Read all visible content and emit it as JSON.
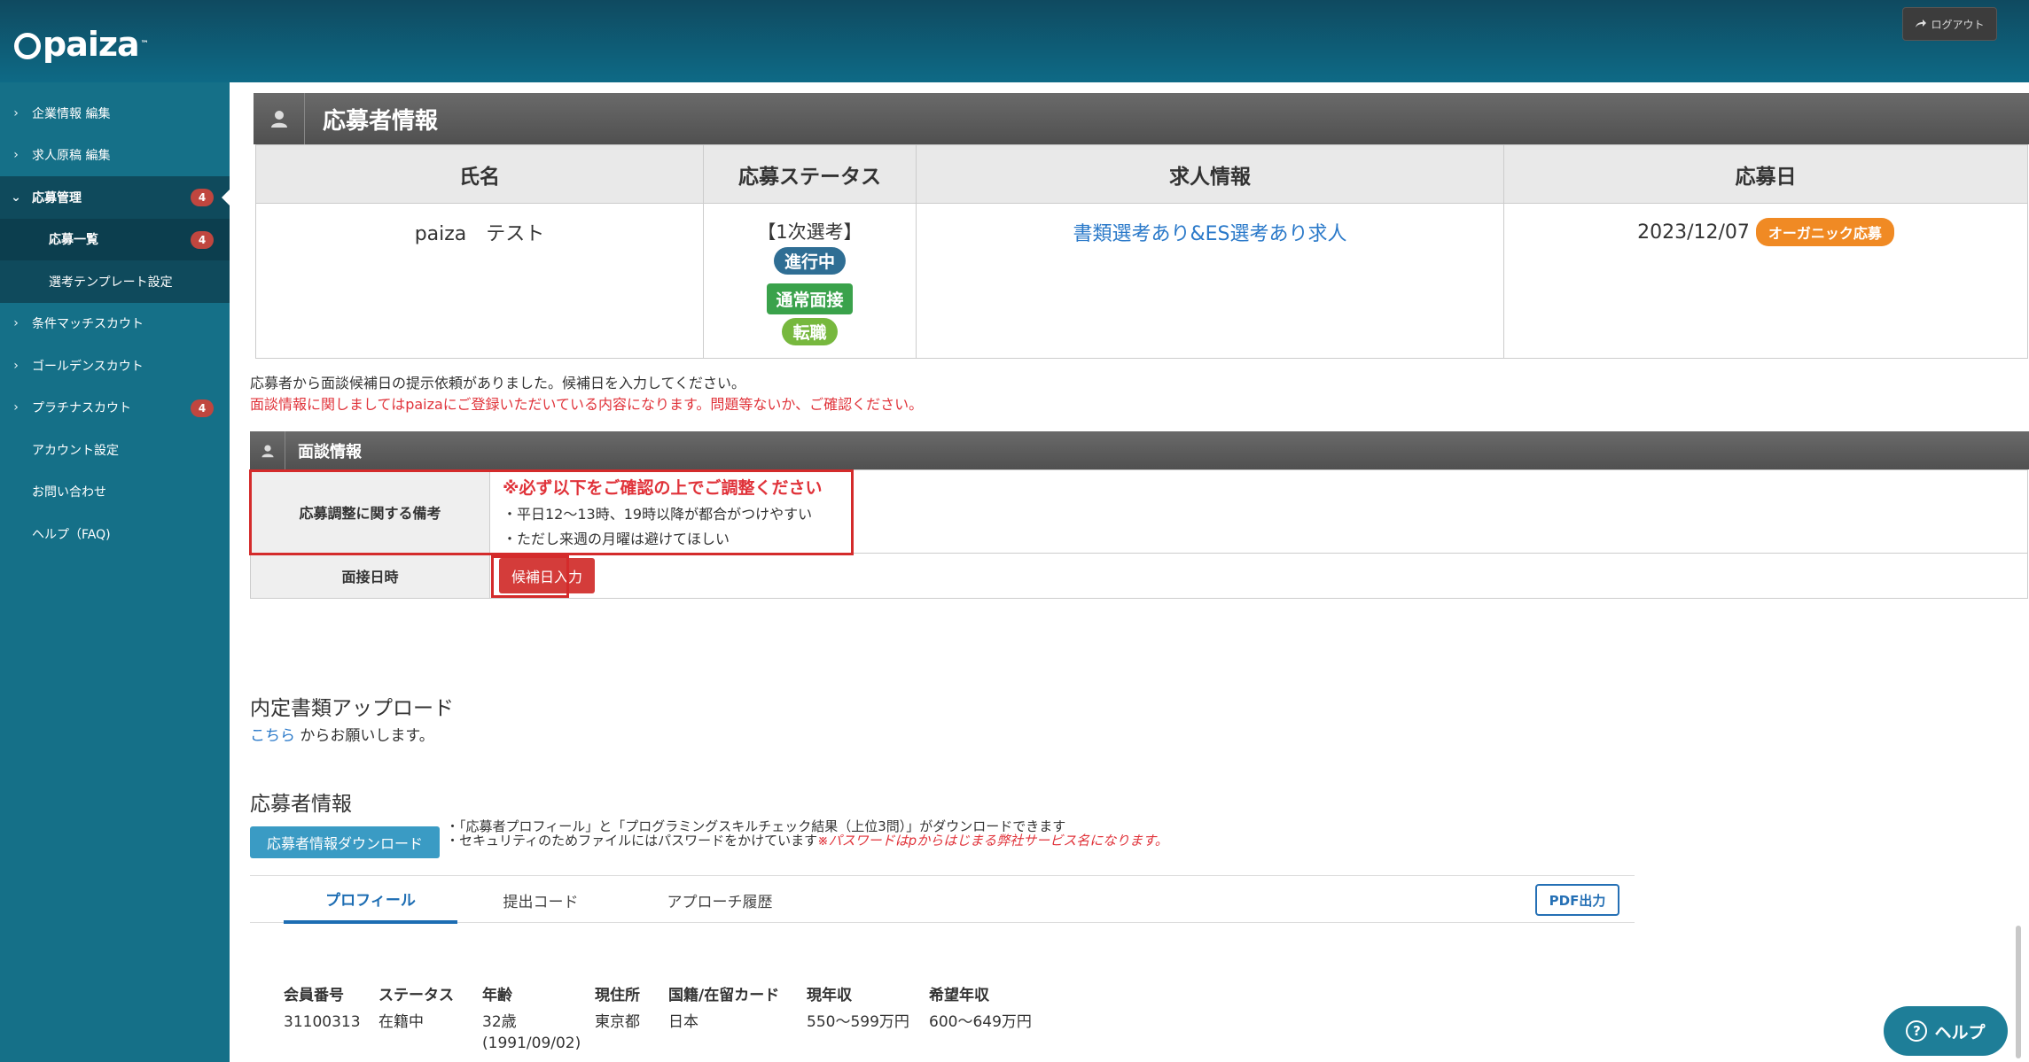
{
  "header": {
    "logo": "paiza",
    "logo_tm": "™",
    "logout_label": "ログアウト"
  },
  "sidebar": {
    "items": [
      {
        "label": "企業情報 編集"
      },
      {
        "label": "求人原稿 編集"
      },
      {
        "label": "応募管理",
        "badge": "4"
      },
      {
        "label": "応募一覧",
        "badge": "4"
      },
      {
        "label": "選考テンプレート設定"
      },
      {
        "label": "条件マッチスカウト"
      },
      {
        "label": "ゴールデンスカウト"
      },
      {
        "label": "プラチナスカウト",
        "badge": "4"
      },
      {
        "label": "アカウント設定"
      },
      {
        "label": "お問い合わせ"
      },
      {
        "label": "ヘルプ（FAQ)"
      }
    ]
  },
  "applicant_section": {
    "title": "応募者情報",
    "columns": [
      "氏名",
      "応募ステータス",
      "求人情報",
      "応募日"
    ],
    "row": {
      "name": "paiza　テスト",
      "stage": "【1次選考】",
      "status_badge": "進行中",
      "interview_badge": "通常面接",
      "type_badge": "転職",
      "job_link": "書類選考あり&ES選考あり求人",
      "date": "2023/12/07",
      "source_badge": "オーガニック応募"
    }
  },
  "notices": {
    "line1": "応募者から面談候補日の提示依頼がありました。候補日を入力してください。",
    "line2": "面談情報に関しましてはpaizaにご登録いただいている内容になります。問題等ないか、ご確認ください。"
  },
  "interview_section": {
    "title": "面談情報",
    "remarks_label": "応募調整に関する備考",
    "remarks_heading": "※必ず以下をご確認の上でご調整ください",
    "remarks_line1": "・平日12〜13時、19時以降が都合がつけやすい",
    "remarks_line2": "・ただし来週の月曜は避けてほしい",
    "date_label": "面接日時",
    "date_button": "候補日入力"
  },
  "offer_upload": {
    "title": "内定書類アップロード",
    "link": "こちら",
    "text": "からお願いします。"
  },
  "applicant_info": {
    "title": "応募者情報",
    "download_button": "応募者情報ダウンロード",
    "note1": "・「応募者プロフィール」と「プログラミングスキルチェック結果（上位3問）」がダウンロードできます",
    "note2": "・セキュリティのためファイルにはパスワードをかけています",
    "note2_red": "※パスワードはpからはじまる弊社サービス名になります。"
  },
  "tabs": {
    "items": [
      "プロフィール",
      "提出コード",
      "アプローチ履歴"
    ],
    "pdf_button": "PDF出力"
  },
  "profile": {
    "member_no_label": "会員番号",
    "member_no": "31100313",
    "status_label": "ステータス",
    "status": "在籍中",
    "age_label": "年齢",
    "age": "32歳",
    "birthdate": "(1991/09/02)",
    "address_label": "現住所",
    "address": "東京都",
    "nationality_label": "国籍/在留カード",
    "nationality": "日本",
    "income_label": "現年収",
    "income": "550〜599万円",
    "desired_label": "希望年収",
    "desired": "600〜649万円"
  },
  "help_button": "ヘルプ",
  "colors": {
    "header": "#0e6a86",
    "sidebar": "#157088",
    "accent_red": "#d43c3a",
    "link_blue": "#2a79c9"
  }
}
